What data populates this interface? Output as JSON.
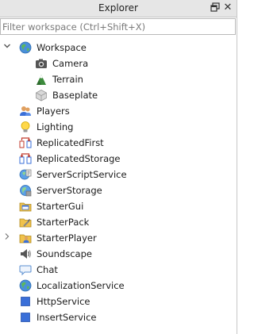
{
  "window": {
    "title": "Explorer",
    "restore_icon": "restore-icon",
    "close_icon": "close-icon"
  },
  "filter": {
    "placeholder": "Filter workspace (Ctrl+Shift+X)",
    "value": ""
  },
  "tree": {
    "workspace": {
      "label": "Workspace",
      "icon": "workspace-globe-icon",
      "expanded": true
    },
    "camera": {
      "label": "Camera",
      "icon": "camera-icon"
    },
    "terrain": {
      "label": "Terrain",
      "icon": "terrain-icon"
    },
    "baseplate": {
      "label": "Baseplate",
      "icon": "part-block-icon"
    },
    "players": {
      "label": "Players",
      "icon": "players-icon"
    },
    "lighting": {
      "label": "Lighting",
      "icon": "lightbulb-icon"
    },
    "replicated_first": {
      "label": "ReplicatedFirst",
      "icon": "replicated-first-icon"
    },
    "replicated_storage": {
      "label": "ReplicatedStorage",
      "icon": "replicated-storage-icon"
    },
    "server_script_service": {
      "label": "ServerScriptService",
      "icon": "server-script-service-icon"
    },
    "server_storage": {
      "label": "ServerStorage",
      "icon": "server-storage-icon"
    },
    "starter_gui": {
      "label": "StarterGui",
      "icon": "starter-gui-icon"
    },
    "starter_pack": {
      "label": "StarterPack",
      "icon": "starter-pack-icon"
    },
    "starter_player": {
      "label": "StarterPlayer",
      "icon": "starter-player-icon",
      "expanded": false
    },
    "soundscape": {
      "label": "Soundscape",
      "icon": "speaker-icon"
    },
    "chat": {
      "label": "Chat",
      "icon": "chat-bubble-icon"
    },
    "localization_service": {
      "label": "LocalizationService",
      "icon": "localization-globe-icon"
    },
    "http_service": {
      "label": "HttpService",
      "icon": "service-square-icon"
    },
    "insert_service": {
      "label": "InsertService",
      "icon": "service-square-icon"
    }
  },
  "colors": {
    "titlebar_bg": "#e6e6e6",
    "service_blue": "#3a6fd8",
    "globe_green": "#4caf50"
  }
}
